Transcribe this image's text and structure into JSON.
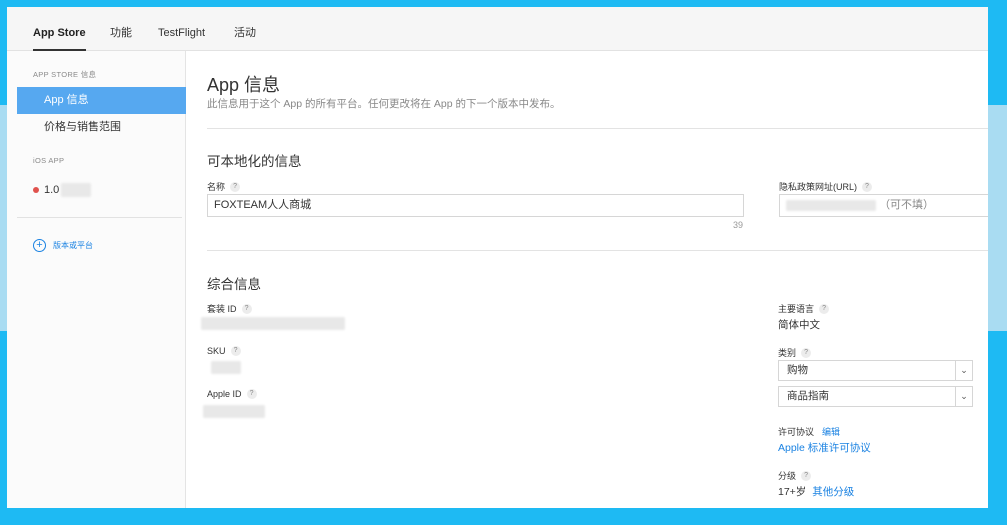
{
  "tabs": [
    {
      "label": "App Store",
      "active": true
    },
    {
      "label": "功能",
      "active": false
    },
    {
      "label": "TestFlight",
      "active": false
    },
    {
      "label": "活动",
      "active": false
    }
  ],
  "sidebar": {
    "section_appstore": "APP STORE 信息",
    "items": [
      {
        "label": "App 信息",
        "active": true
      },
      {
        "label": "价格与销售范围",
        "active": false
      }
    ],
    "section_ios": "iOS APP",
    "version_label": "1.0",
    "add_platform_label": "版本或平台"
  },
  "main": {
    "title": "App 信息",
    "subtitle": "此信息用于这个 App 的所有平台。任何更改将在 App 的下一个版本中发布。",
    "localizable_title": "可本地化的信息",
    "name_label": "名称",
    "name_value": "FOXTEAM人人商城",
    "name_char_count": "39",
    "privacy_label": "隐私政策网址(URL)",
    "privacy_placeholder": "（可不填）",
    "general_title": "综合信息",
    "bundle_id_label": "套装 ID",
    "sku_label": "SKU",
    "apple_id_label": "Apple ID",
    "primary_language_label": "主要语言",
    "primary_language_value": "简体中文",
    "category_label": "类别",
    "category_primary": "购物",
    "category_secondary": "商品指南",
    "license_label": "许可协议",
    "license_edit": "编辑",
    "license_link": "Apple 标准许可协议",
    "rating_label": "分级",
    "rating_value": "17+岁",
    "rating_link": "其他分级",
    "help_glyph": "?"
  },
  "colors": {
    "accent": "#1a82e2",
    "sidebar_active": "#56a8f0",
    "version_dot": "#e0524d",
    "background_frame": "#1ebaf3"
  }
}
